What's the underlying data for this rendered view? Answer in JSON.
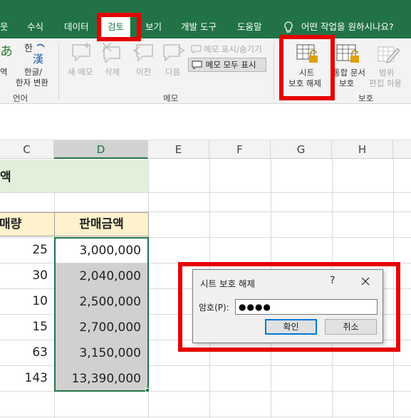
{
  "tabs": {
    "partial": "웃",
    "formulas": "수식",
    "data": "데이터",
    "review": "검토",
    "view": "보기",
    "developer": "개발 도구",
    "help": "도움말",
    "tellme": "어떤 작업을 원하시나요?"
  },
  "ribbon": {
    "translate": "역",
    "hanja_line1": "한글/",
    "hanja_line2": "한자 변환",
    "group_language": "언어",
    "new_comment": "새 메모",
    "delete": "삭제",
    "previous": "이전",
    "next": "다음",
    "show_hide_comment": "메모 표시/숨기기",
    "show_all_comments": "메모 모두 표시",
    "group_comments": "메모",
    "unprotect_sheet_line1": "시트",
    "unprotect_sheet_line2": "보호 해제",
    "protect_workbook_line1": "통합 문서",
    "protect_workbook_line2": "보호",
    "allow_edit_line1": "범위",
    "allow_edit_line2": "편집 허용",
    "group_protect": "보호"
  },
  "columns": [
    "C",
    "D",
    "E",
    "F",
    "G",
    "H"
  ],
  "sheet": {
    "title_fragment": "액",
    "header_c": "매량",
    "header_d": "판매금액",
    "rows": [
      {
        "qty": "25",
        "amount": "3,000,000"
      },
      {
        "qty": "30",
        "amount": "2,040,000"
      },
      {
        "qty": "10",
        "amount": "2,500,000"
      },
      {
        "qty": "15",
        "amount": "2,700,000"
      },
      {
        "qty": "63",
        "amount": "3,150,000"
      },
      {
        "qty": "143",
        "amount": "13,390,000"
      }
    ]
  },
  "dialog": {
    "title": "시트 보호 해제",
    "help": "?",
    "password_label": "암호(P):",
    "password_value": "●●●●",
    "ok": "확인",
    "cancel": "취소"
  },
  "colors": {
    "excel_green": "#217346",
    "highlight_red": "#e60000",
    "title_fill": "#e2efda",
    "header_fill": "#fff2cc",
    "selected_cell_fill": "#d0d0d0"
  }
}
